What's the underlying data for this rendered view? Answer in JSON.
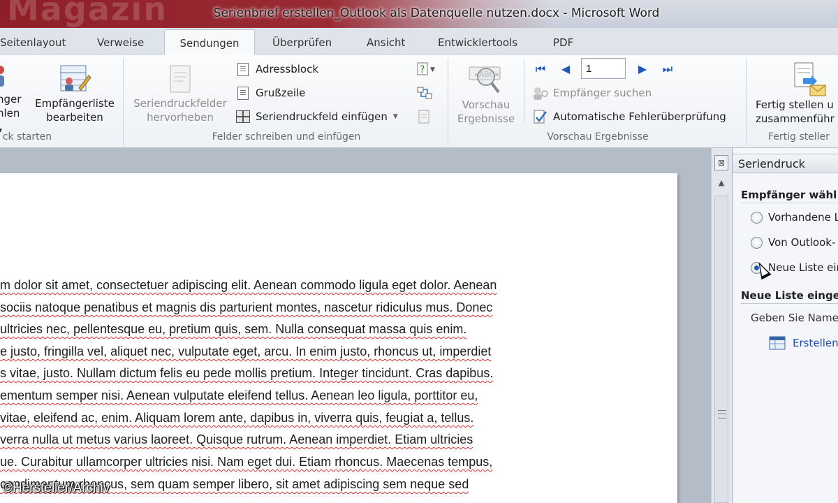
{
  "window": {
    "title": "Serienbrief erstellen_Outlook als Datenquelle nutzen.docx - Microsoft Word",
    "watermark": "Magazin"
  },
  "tabs": [
    "Seitenlayout",
    "Verweise",
    "Sendungen",
    "Überprüfen",
    "Ansicht",
    "Entwicklertools",
    "PDF"
  ],
  "active_tab": "Sendungen",
  "ribbon": {
    "start_group": {
      "recipients_label_line1": "nger",
      "recipients_label_line2": "hlen",
      "edit_list_line1": "Empfängerliste",
      "edit_list_line2": "bearbeiten",
      "group_label": "ck starten"
    },
    "fields_group": {
      "highlight_line1": "Seriendruckfelder",
      "highlight_line2": "hervorheben",
      "address_block": "Adressblock",
      "greeting_line": "Grußzeile",
      "insert_field": "Seriendruckfeld einfügen",
      "group_label": "Felder schreiben und einfügen"
    },
    "preview_group": {
      "preview_line1": "Vorschau",
      "preview_line2": "Ergebnisse",
      "record_number": "1",
      "find_recipient": "Empfänger suchen",
      "auto_check": "Automatische Fehlerüberprüfung",
      "group_label": "Vorschau Ergebnisse"
    },
    "finish_group": {
      "finish_line1": "Fertig stellen u",
      "finish_line2": "zusammenführ",
      "group_label": "Fertig steller"
    }
  },
  "document": {
    "lines": [
      "m dolor sit amet, consectetuer adipiscing elit. Aenean commodo ligula eget dolor. Aenean",
      " sociis natoque penatibus et magnis dis parturient montes, nascetur ridiculus mus. Donec",
      "ultricies nec, pellentesque eu, pretium quis, sem. Nulla consequat massa quis enim.",
      "e justo, fringilla vel, aliquet nec, vulputate eget, arcu. In enim justo, rhoncus ut, imperdiet",
      "s vitae, justo. Nullam dictum felis eu pede mollis pretium. Integer tincidunt. Cras dapibus.",
      "ementum semper nisi. Aenean vulputate eleifend tellus. Aenean leo ligula, porttitor eu,",
      "vitae, eleifend ac, enim. Aliquam lorem ante, dapibus in, viverra quis, feugiat a, tellus.",
      "verra nulla ut metus varius laoreet. Quisque rutrum. Aenean imperdiet. Etiam ultricies",
      "ue. Curabitur ullamcorper ultricies nisi. Nam eget dui. Etiam rhoncus. Maecenas tempus,",
      " condimentum rhoncus, sem quam semper libero, sit amet adipiscing sem neque sed"
    ]
  },
  "task_pane": {
    "title": "Seriendruck",
    "section_select": "Empfänger wähl",
    "option_existing": "Vorhandene L",
    "option_outlook": "Von Outlook-",
    "option_new": "Neue Liste ein",
    "section_new": "Neue Liste einge",
    "prompt_text": "Geben Sie Namen",
    "create_link": "Erstellen"
  },
  "copyright": "©Hersteller/Archiv"
}
